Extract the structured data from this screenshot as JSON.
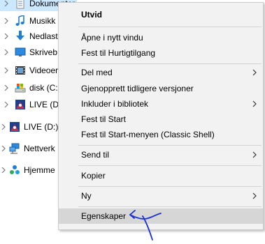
{
  "tree": {
    "items": [
      {
        "label": "Dokumenter",
        "icon": "documents-icon"
      },
      {
        "label": "Musikk",
        "icon": "music-icon"
      },
      {
        "label": "Nedlast",
        "icon": "downloads-icon"
      },
      {
        "label": "Skriveb",
        "icon": "desktop-icon"
      },
      {
        "label": "Videoer",
        "icon": "videos-icon"
      },
      {
        "label": "disk (C:",
        "icon": "drive-icon"
      },
      {
        "label": "LIVE (D:",
        "icon": "dvd-drive-icon"
      },
      {
        "label": "LIVE (D:)",
        "icon": "dvd-drive-icon"
      },
      {
        "label": "Nettverk",
        "icon": "network-icon"
      },
      {
        "label": "Hjemme",
        "icon": "homegroup-icon"
      }
    ]
  },
  "menu": {
    "items": [
      {
        "label": "Utvid",
        "bold": true
      },
      {
        "label": "Åpne i nytt vindu"
      },
      {
        "label": "Fest til Hurtigtilgang"
      },
      {
        "label": "Del med",
        "submenu": true
      },
      {
        "label": "Gjenopprett tidligere versjoner"
      },
      {
        "label": "Inkluder i bibliotek",
        "submenu": true
      },
      {
        "label": "Fest til Start"
      },
      {
        "label": "Fest til Start-menyen (Classic Shell)"
      },
      {
        "label": "Send til",
        "submenu": true
      },
      {
        "label": "Kopier"
      },
      {
        "label": "Ny",
        "submenu": true
      },
      {
        "label": "Egenskaper",
        "highlighted": true
      }
    ]
  },
  "colors": {
    "menu_bg": "#f2f2f2",
    "menu_hover": "#d6d6d6",
    "tree_selected": "#cce8ff",
    "annotation_arrow": "#1a2fd6"
  }
}
